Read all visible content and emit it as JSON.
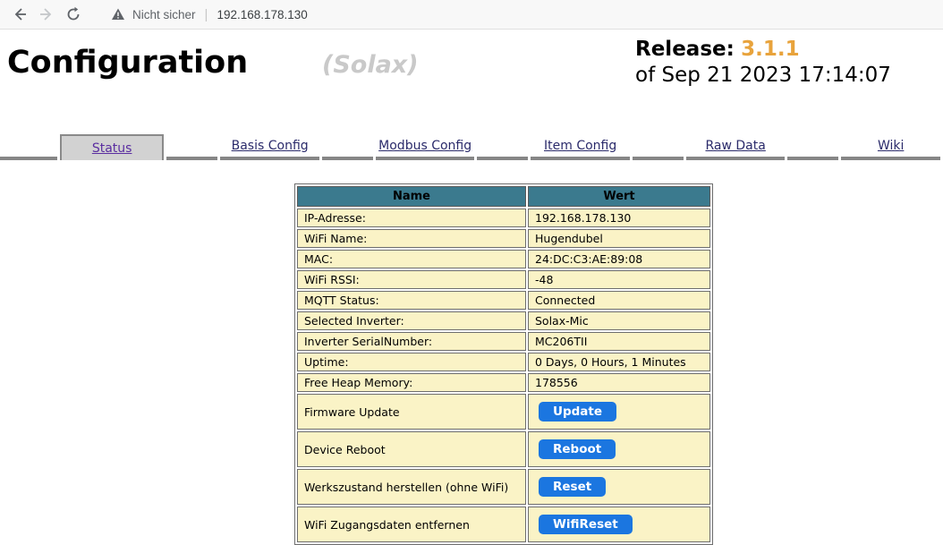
{
  "browser": {
    "security_label": "Nicht sicher",
    "url": "192.168.178.130",
    "icons": [
      "back-icon",
      "forward-icon",
      "reload-icon",
      "warning-icon"
    ]
  },
  "header": {
    "title": "Configuration",
    "subtitle": "(Solax)",
    "release_label": "Release:",
    "release_version": "3.1.1",
    "release_date_line": "of Sep 21 2023 17:14:07"
  },
  "tabs": [
    {
      "label": "Status",
      "active": true
    },
    {
      "label": "Basis Config",
      "active": false
    },
    {
      "label": "Modbus Config",
      "active": false
    },
    {
      "label": "Item Config",
      "active": false
    },
    {
      "label": "Raw Data",
      "active": false
    },
    {
      "label": "Wiki",
      "active": false
    }
  ],
  "status_table": {
    "columns": [
      "Name",
      "Wert"
    ],
    "rows": [
      {
        "label": "IP-Adresse:",
        "value": "192.168.178.130"
      },
      {
        "label": "WiFi Name:",
        "value": "Hugendubel"
      },
      {
        "label": "MAC:",
        "value": "24:DC:C3:AE:89:08"
      },
      {
        "label": "WiFi RSSI:",
        "value": "-48"
      },
      {
        "label": "MQTT Status:",
        "value": "Connected"
      },
      {
        "label": "Selected Inverter:",
        "value": "Solax-Mic"
      },
      {
        "label": "Inverter SerialNumber:",
        "value": "MC206TII"
      },
      {
        "label": "Uptime:",
        "value": "0 Days, 0 Hours, 1 Minutes"
      },
      {
        "label": "Free Heap Memory:",
        "value": "178556"
      },
      {
        "label": "Firmware Update",
        "button": "Update"
      },
      {
        "label": "Device Reboot",
        "button": "Reboot"
      },
      {
        "label": "Werkszustand herstellen (ohne WiFi)",
        "button": "Reset"
      },
      {
        "label": "WiFi Zugangsdaten entfernen",
        "button": "WifiReset"
      }
    ]
  },
  "colors": {
    "release_version_orange": "#E8A33C",
    "table_header_teal": "#3B7A8E",
    "row_yellow": "#FAF3C6",
    "button_blue": "#1B76E0",
    "tab_line_gray": "#868686",
    "tab_link_navy": "#2B2B6B",
    "active_tab_link_purple": "#5A2DA0"
  }
}
